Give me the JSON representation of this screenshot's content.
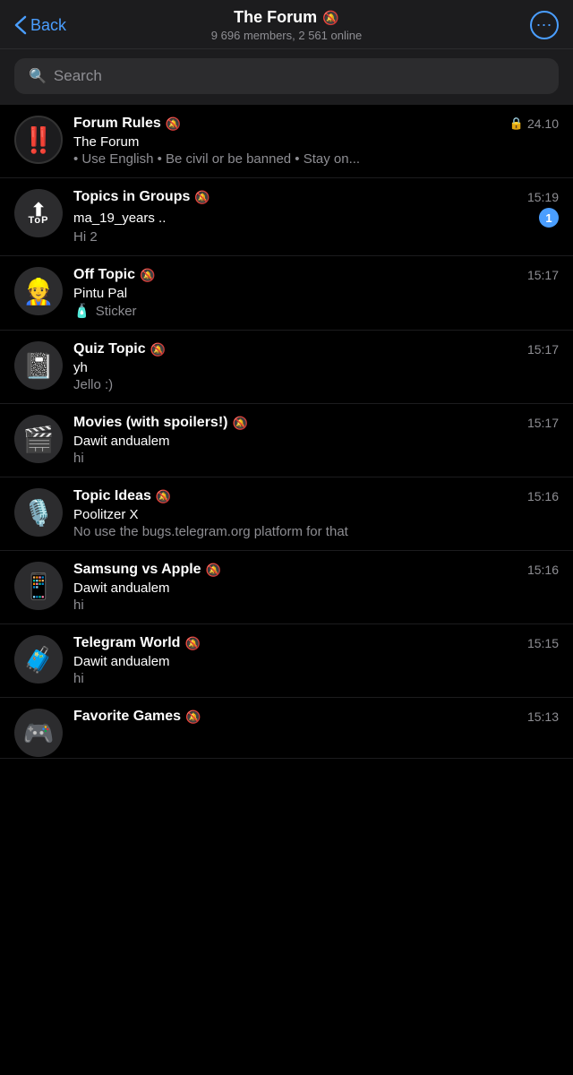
{
  "header": {
    "back_label": "Back",
    "title": "The Forum",
    "members": "9 696 members, 2 561 online",
    "more_icon": "⋯"
  },
  "search": {
    "placeholder": "Search"
  },
  "chats": [
    {
      "id": "forum-rules",
      "avatar_type": "emoji",
      "avatar_content": "‼️",
      "name": "Forum Rules",
      "muted": true,
      "time": "24.10",
      "locked": true,
      "sender": "The Forum",
      "preview": "• Use English • Be civil or be banned • Stay on...",
      "badge": null
    },
    {
      "id": "topics-in-groups",
      "avatar_type": "top",
      "avatar_content": "TOP",
      "name": "Topics in Groups",
      "muted": true,
      "time": "15:19",
      "locked": false,
      "sender": "ma_19_years ..",
      "preview": "Hi 2",
      "badge": "1"
    },
    {
      "id": "off-topic",
      "avatar_type": "emoji",
      "avatar_content": "👷",
      "name": "Off Topic",
      "muted": true,
      "time": "15:17",
      "locked": false,
      "sender": "Pintu Pal",
      "preview_type": "sticker",
      "preview": "Sticker",
      "badge": null
    },
    {
      "id": "quiz-topic",
      "avatar_type": "emoji",
      "avatar_content": "📓",
      "name": "Quiz Topic",
      "muted": true,
      "time": "15:17",
      "locked": false,
      "sender": "yh",
      "preview": "Jello :)",
      "badge": null
    },
    {
      "id": "movies",
      "avatar_type": "emoji",
      "avatar_content": "🎬",
      "name": "Movies (with spoilers!)",
      "muted": true,
      "time": "15:17",
      "locked": false,
      "sender": "Dawit andualem",
      "preview": "hi",
      "badge": null
    },
    {
      "id": "topic-ideas",
      "avatar_type": "emoji",
      "avatar_content": "🎙️",
      "name": "Topic Ideas",
      "muted": true,
      "time": "15:16",
      "locked": false,
      "sender": "Poolitzer X",
      "preview": "No use the bugs.telegram.org platform for that",
      "badge": null
    },
    {
      "id": "samsung-vs-apple",
      "avatar_type": "emoji",
      "avatar_content": "📱",
      "name": "Samsung vs Apple",
      "muted": true,
      "time": "15:16",
      "locked": false,
      "sender": "Dawit andualem",
      "preview": "hi",
      "badge": null
    },
    {
      "id": "telegram-world",
      "avatar_type": "emoji",
      "avatar_content": "🧳",
      "name": "Telegram World",
      "muted": true,
      "time": "15:15",
      "locked": false,
      "sender": "Dawit andualem",
      "preview": "hi",
      "badge": null
    },
    {
      "id": "favorite-games",
      "avatar_type": "emoji",
      "avatar_content": "🎮",
      "name": "Favorite Games",
      "muted": true,
      "time": "15:13",
      "locked": false,
      "sender": "",
      "preview": "",
      "badge": null,
      "partial": true
    }
  ]
}
